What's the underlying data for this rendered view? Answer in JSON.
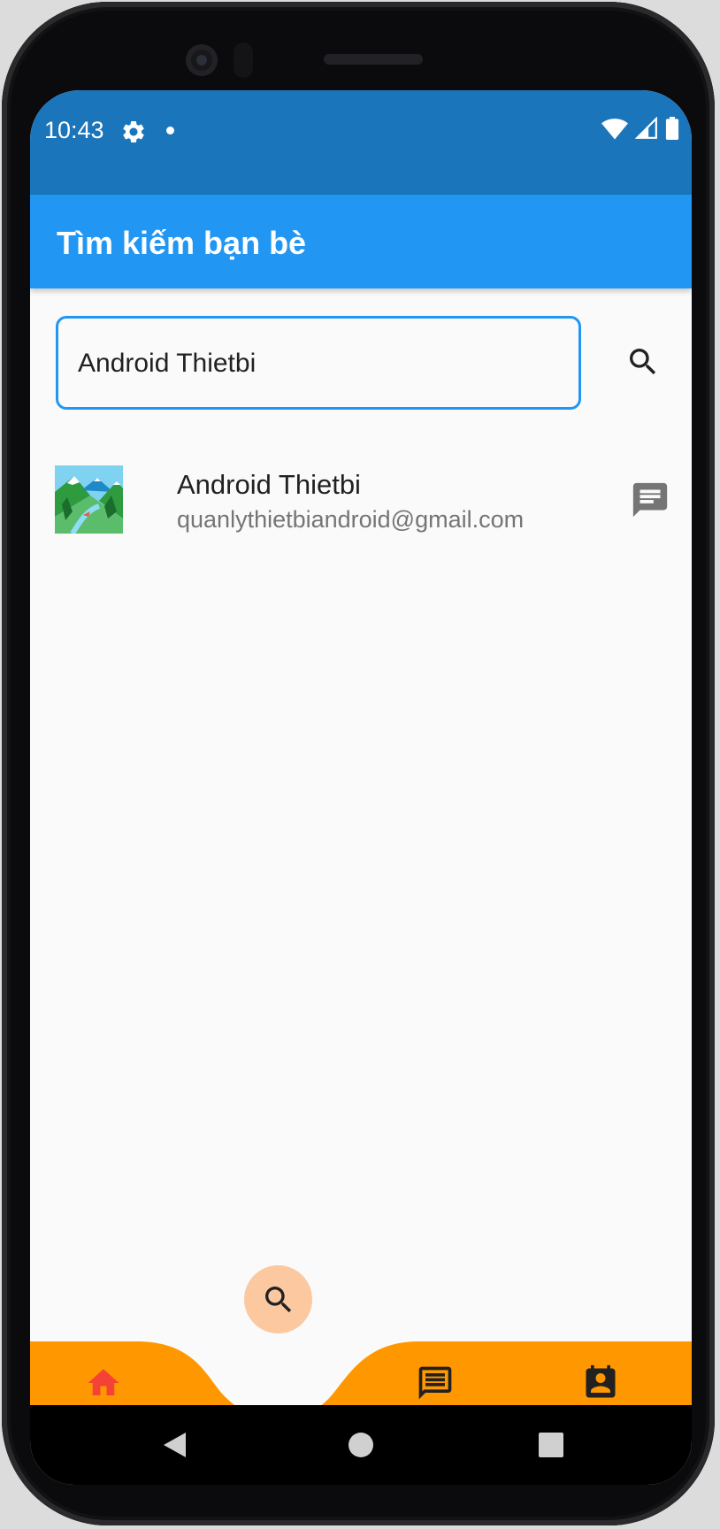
{
  "status_bar": {
    "time": "10:43",
    "icons": [
      "settings-icon",
      "notification-dot-icon",
      "wifi-icon",
      "signal-icon",
      "battery-icon"
    ],
    "background": "#1b75bb"
  },
  "app_bar": {
    "title": "Tìm kiếm bạn bè",
    "background": "#2196f3"
  },
  "search": {
    "value": "Android Thietbi",
    "border_color": "#2196f3",
    "button_icon": "search-icon"
  },
  "results": [
    {
      "name": "Android Thietbi",
      "email": "quanlythietbiandroid@gmail.com",
      "avatar_icon": "landscape-avatar-icon",
      "action_icon": "message-icon"
    }
  ],
  "bottom_nav": {
    "background": "#ff9800",
    "active_background": "#fbc8a0",
    "items": [
      {
        "icon": "home-icon",
        "color": "#f44336"
      },
      {
        "icon": "search-icon",
        "active": true
      },
      {
        "icon": "chat-icon"
      },
      {
        "icon": "contacts-icon"
      }
    ]
  },
  "system_nav": {
    "buttons": [
      "back-icon",
      "home-circle-icon",
      "recents-icon"
    ]
  }
}
